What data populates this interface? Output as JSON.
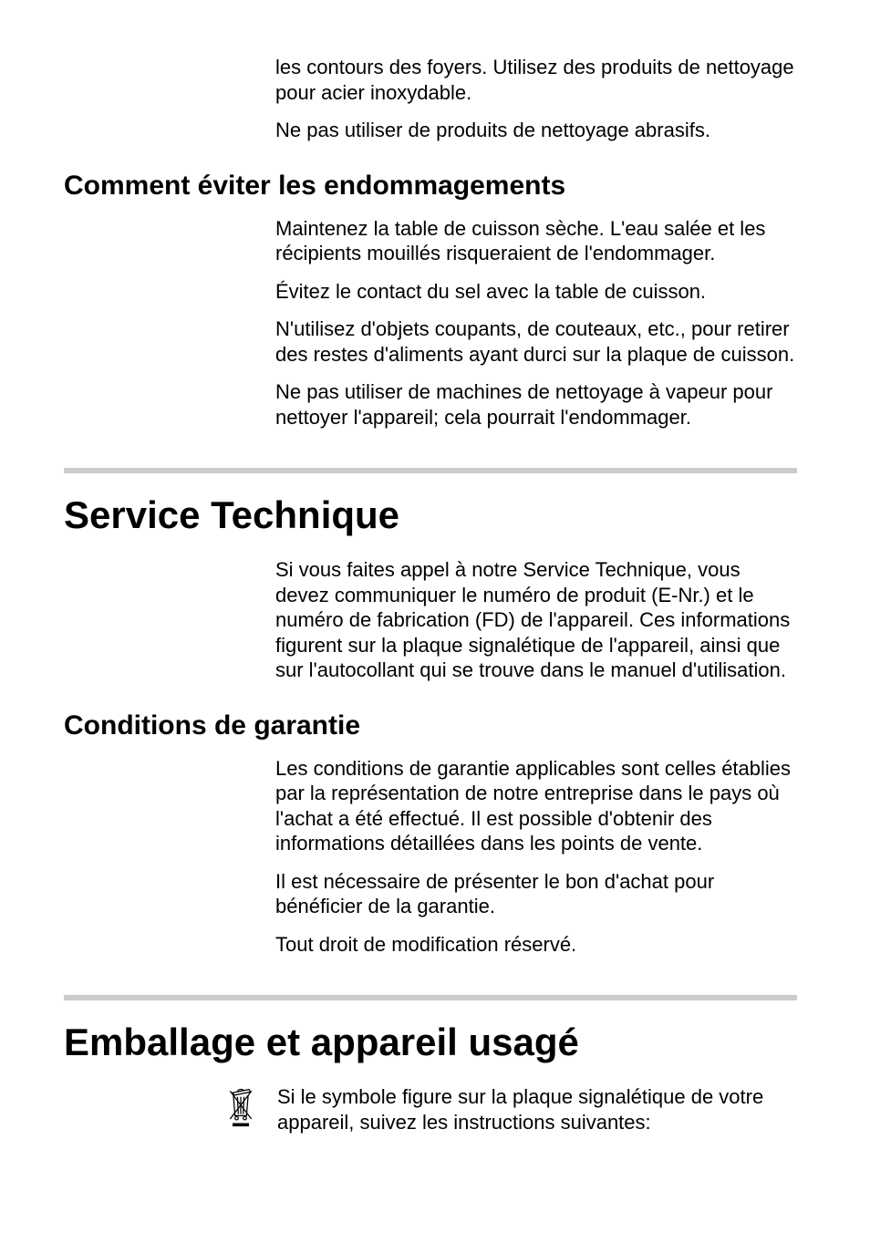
{
  "intro": {
    "p1": "les contours des foyers. Utilisez des produits de nettoyage pour acier inoxydable.",
    "p2": "Ne pas utiliser de produits de nettoyage abrasifs."
  },
  "section_endommagements": {
    "heading": "Comment éviter les endommagements",
    "p1": "Maintenez la table de cuisson sèche. L'eau salée et les récipients mouillés risqueraient de l'endommager.",
    "p2": "Évitez le contact du sel avec la table de cuisson.",
    "p3": "N'utilisez d'objets coupants, de couteaux, etc., pour retirer des restes d'aliments ayant durci sur la plaque de cuisson.",
    "p4": "Ne pas utiliser de machines de nettoyage à vapeur pour nettoyer l'appareil; cela pourrait l'endommager."
  },
  "section_service": {
    "heading": "Service Technique",
    "p1": "Si vous faites appel à notre Service Technique, vous devez communiquer le numéro de produit (E-Nr.) et le numéro de fabrication (FD) de l'appareil. Ces informations figurent sur la plaque signalétique de l'appareil, ainsi que sur l'autocollant qui se trouve dans le manuel d'utilisation."
  },
  "section_garantie": {
    "heading": "Conditions de garantie",
    "p1": "Les conditions de garantie applicables sont celles établies par la représentation de notre entreprise dans le pays où l'achat a été effectué. Il est possible d'obtenir des informations détaillées dans les points de vente.",
    "p2": "Il est nécessaire de présenter le bon d'achat pour bénéficier de la garantie.",
    "p3": "Tout droit de modification réservé."
  },
  "section_emballage": {
    "heading": "Emballage et appareil usagé",
    "p1": "Si le symbole figure sur la plaque signalétique de votre appareil, suivez les instructions suivantes:"
  }
}
